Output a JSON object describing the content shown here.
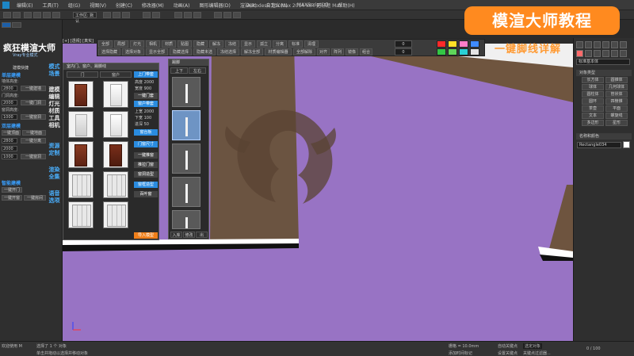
{
  "window": {
    "title": "Autodesk 3ds Max 2014 x64    无标题 Max",
    "menu_items": [
      "编辑(E)",
      "工具(T)",
      "组(G)",
      "视图(V)",
      "创建(C)",
      "修改器(M)",
      "动画(A)",
      "图形编辑器(D)",
      "渲染(R)",
      "自定义(U)",
      "MAXScript(X)",
      "帮助(H)"
    ],
    "workspace_label": "工作区: 默认"
  },
  "left_panel": {
    "brand_title": "疯狂模渲大师",
    "brand_subtitle": "Vray专业模式",
    "top_tab": "建模快捷",
    "sections": [
      {
        "label": "单层建模"
      },
      {
        "label": "双层建模"
      },
      {
        "label": "智能建模"
      }
    ],
    "fields": {
      "wall_height_label": "墙体高度:",
      "wall_height_value": "2800",
      "door_height_label": "门洞高度:",
      "door_height_value": "2000",
      "window_height_label": "窗洞高度:",
      "window_height_value": "1000",
      "btn_one_click_wall": "一键建墙",
      "btn_one_click_door": "一键门洞",
      "btn_one_click_window": "一键窗洞",
      "btn_one_click_roof": "一键顶面",
      "btn_one_click_floor": "一键地面",
      "btn_one_click_split": "一键分离",
      "btn_smart_door": "一键开门",
      "btn_smart_window": "一键开窗",
      "btn_smart_room": "一键房间"
    },
    "mode_tabs_blue": [
      "模式",
      "场景"
    ],
    "mode_tabs_white": [
      "建模",
      "编辑",
      "灯光",
      "材质",
      "工具",
      "相机"
    ],
    "mode_tabs_blue_bottom": [
      "资源",
      "定制",
      "渲染",
      "全集",
      "语音",
      "选项"
    ]
  },
  "viewport": {
    "label": "[+] [透视] [真实]",
    "axis_label": "Z"
  },
  "plugin_bar": {
    "row1": [
      "全部",
      "局部",
      "灯光",
      "相机",
      "材质",
      "贴图",
      "隐藏",
      "解冻",
      "冻结",
      "显示",
      "孤立",
      "分离",
      "标准",
      "清理"
    ],
    "row2": [
      "选择隐藏",
      "选择对象",
      "显示全部",
      "隐藏选择",
      "隐藏未选",
      "冻结选择",
      "解冻全部",
      "材质编辑器",
      "全部解除",
      "对齐",
      "阵列",
      "镜像",
      "组合"
    ],
    "value_a": "0",
    "value_b": "0",
    "swatches": [
      "#ff2a2a",
      "#ffe027",
      "#ff7dc7",
      "#3f8bff",
      "#33c645",
      "#5fd65a",
      "#2ad0d6",
      "#e4e4e4"
    ]
  },
  "library": {
    "title": "室内门、窗户、踢脚线",
    "tabs": [
      "门",
      "窗户"
    ],
    "side_buttons": [
      "上门带套",
      "一键门套",
      "窗户带套",
      "窗台板",
      "门窗尺寸",
      "一键推窗",
      "推拉门窗",
      "窗洞造型",
      "窗框造型",
      "百叶窗"
    ],
    "fields": [
      {
        "label": "高度",
        "value": "2000"
      },
      {
        "label": "宽度",
        "value": "900"
      },
      {
        "label": "上宽",
        "value": "2000"
      },
      {
        "label": "下宽",
        "value": "100"
      },
      {
        "label": "进深",
        "value": "50"
      }
    ],
    "bottom_button": "导入模型"
  },
  "profile_panel": {
    "title": "踢脚",
    "tabs": [
      "上下",
      "左右"
    ],
    "bottom_buttons": [
      "入库",
      "修改",
      "出"
    ]
  },
  "right_panel": {
    "dropdown": "标准基本体",
    "header1": "对象类型",
    "buttons": [
      "长方体",
      "圆锥体",
      "球体",
      "几何球体",
      "圆柱体",
      "管状体",
      "圆环",
      "四棱锥",
      "茶壶",
      "平面",
      "文本",
      "螺旋线",
      "多边形",
      "星形"
    ],
    "header2": "名称和颜色",
    "name_field": "Rectangle034"
  },
  "status": {
    "selected": "选择了 1 个 对象",
    "hint": "单击并拖动以选择并移动对象",
    "welcome": "欢迎使用 M",
    "grid": "栅格 = 10.0mm",
    "auto_key": "自动关键点",
    "set_key": "设置关键点",
    "key_filter": "关键点过滤器...",
    "selected_mode": "选定对象",
    "time_marker": "添加时间标记",
    "frame": "0 / 100"
  },
  "overlay": {
    "banner": "模渲大师教程",
    "subtitle": "一键脚线详解"
  }
}
